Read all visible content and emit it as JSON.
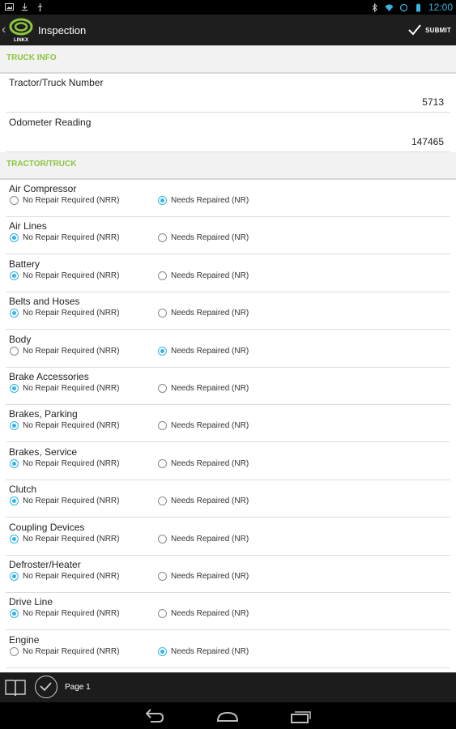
{
  "status_bar": {
    "time": "12:00",
    "icons": [
      "picture-icon",
      "download-icon",
      "usb-icon",
      "bluetooth-icon",
      "wifi-icon",
      "sync-icon",
      "battery-icon"
    ]
  },
  "action_bar": {
    "title": "Inspection",
    "logo_text": "LINKX",
    "submit_label": "SUBMIT"
  },
  "colors": {
    "section_header": "#8dc63f",
    "radio_selected": "#33b5e5",
    "action_bar": "#1e1e1e"
  },
  "truck_info": {
    "header": "TRUCK INFO",
    "fields": [
      {
        "label": "Tractor/Truck Number",
        "value": "5713"
      },
      {
        "label": "Odometer Reading",
        "value": "147465"
      }
    ]
  },
  "tractor_truck": {
    "header": "TRACTOR/TRUCK",
    "option_nrr": "No Repair Required (NRR)",
    "option_nr": "Needs Repaired (NR)",
    "items": [
      {
        "label": "Air Compressor",
        "selected": "nr"
      },
      {
        "label": "Air Lines",
        "selected": "nrr"
      },
      {
        "label": "Battery",
        "selected": "nrr"
      },
      {
        "label": "Belts and Hoses",
        "selected": "nrr"
      },
      {
        "label": "Body",
        "selected": "nr"
      },
      {
        "label": "Brake Accessories",
        "selected": "nrr"
      },
      {
        "label": "Brakes, Parking",
        "selected": "nrr"
      },
      {
        "label": "Brakes, Service",
        "selected": "nrr"
      },
      {
        "label": "Clutch",
        "selected": "nrr"
      },
      {
        "label": "Coupling Devices",
        "selected": "nrr"
      },
      {
        "label": "Defroster/Heater",
        "selected": "nrr"
      },
      {
        "label": "Drive Line",
        "selected": "nrr"
      },
      {
        "label": "Engine",
        "selected": "nr"
      }
    ]
  },
  "bottom_bar": {
    "page_label": "Page 1"
  }
}
